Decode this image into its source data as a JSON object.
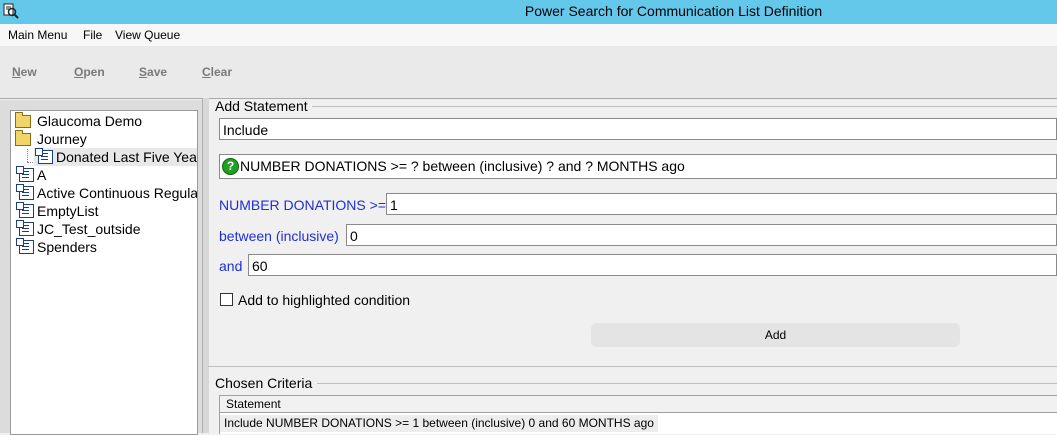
{
  "window": {
    "title": "Power Search for Communication List Definition"
  },
  "menu": {
    "items": [
      "Main Menu",
      "File",
      "View Queue"
    ]
  },
  "toolbar": {
    "new_label": "New",
    "open_label": "Open",
    "save_label": "Save",
    "clear_label": "Clear"
  },
  "tree": {
    "items": [
      {
        "label": "Glaucoma Demo",
        "icon": "folder-icon"
      },
      {
        "label": "Journey",
        "icon": "folder-icon"
      },
      {
        "label": "Donated Last Five Yea",
        "icon": "list-icon"
      },
      {
        "label": "A",
        "icon": "list-icon"
      },
      {
        "label": "Active Continuous Regula",
        "icon": "list-icon"
      },
      {
        "label": "EmptyList",
        "icon": "list-icon"
      },
      {
        "label": "JC_Test_outside",
        "icon": "list-icon"
      },
      {
        "label": "Spenders",
        "icon": "list-icon"
      }
    ]
  },
  "add_statement": {
    "title": "Add Statement",
    "include_value": "Include",
    "condition_text": "NUMBER DONATIONS >= ? between (inclusive) ? and ? MONTHS ago",
    "params": [
      {
        "label": "NUMBER DONATIONS >=",
        "value": "1"
      },
      {
        "label": "between (inclusive)",
        "value": "0"
      },
      {
        "label": "and",
        "value": "60"
      }
    ],
    "checkbox_label": "Add to highlighted condition",
    "checkbox_checked": false,
    "add_button": "Add"
  },
  "chosen_criteria": {
    "title": "Chosen Criteria",
    "column_header": "Statement",
    "rows": [
      "Include NUMBER DONATIONS >= 1 between (inclusive) 0 and 60 MONTHS ago"
    ]
  },
  "colors": {
    "titlebar": "#63c8ea",
    "param_label": "#1f2fd8",
    "help_icon": "#23a023"
  }
}
